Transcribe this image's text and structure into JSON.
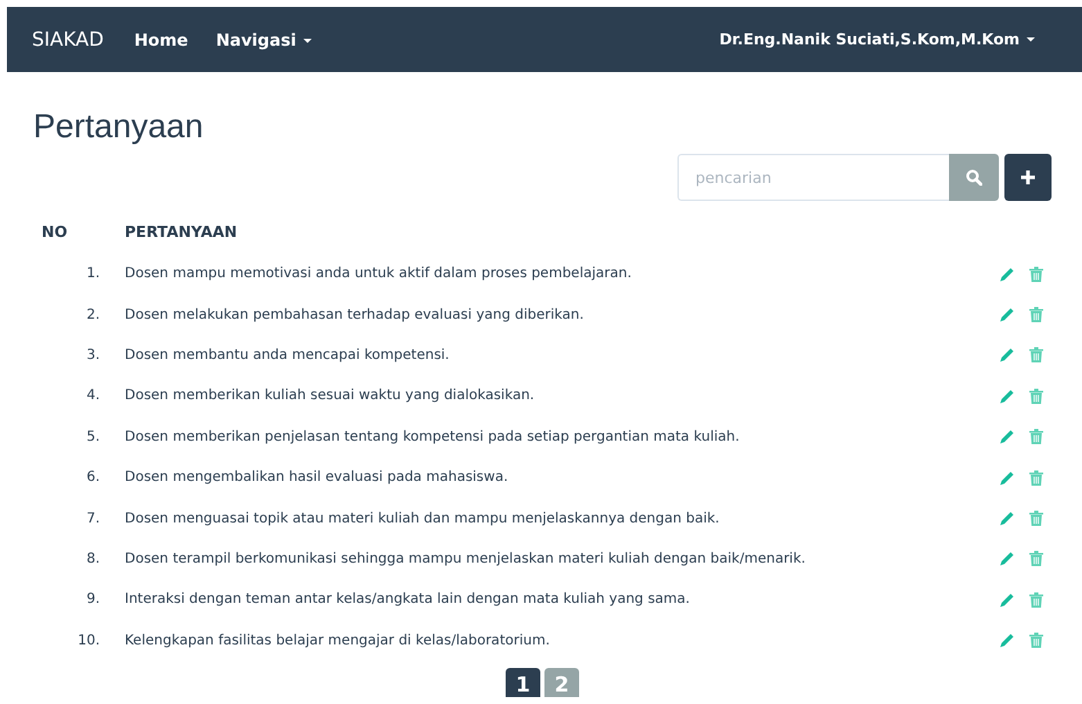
{
  "navbar": {
    "brand": "SIAKAD",
    "items": [
      {
        "label": "Home",
        "dropdown": false
      },
      {
        "label": "Navigasi",
        "dropdown": true
      }
    ],
    "user": {
      "label": "Dr.Eng.Nanik Suciati,S.Kom,M.Kom",
      "dropdown": true
    }
  },
  "title": "Pertanyaan",
  "search": {
    "placeholder": "pencarian"
  },
  "table": {
    "columns": [
      "NO",
      "PERTANYAAN"
    ],
    "rows": [
      {
        "no": "1.",
        "text": "Dosen mampu memotivasi anda untuk aktif dalam proses pembelajaran."
      },
      {
        "no": "2.",
        "text": "Dosen melakukan pembahasan terhadap evaluasi yang diberikan."
      },
      {
        "no": "3.",
        "text": "Dosen membantu anda mencapai kompetensi."
      },
      {
        "no": "4.",
        "text": "Dosen memberikan kuliah sesuai waktu yang dialokasikan."
      },
      {
        "no": "5.",
        "text": "Dosen memberikan penjelasan tentang kompetensi pada setiap pergantian mata kuliah."
      },
      {
        "no": "6.",
        "text": "Dosen mengembalikan hasil evaluasi pada mahasiswa."
      },
      {
        "no": "7.",
        "text": "Dosen menguasai topik atau materi kuliah dan mampu menjelaskannya dengan baik."
      },
      {
        "no": "8.",
        "text": "Dosen terampil berkomunikasi sehingga mampu menjelaskan materi kuliah dengan baik/menarik."
      },
      {
        "no": "9.",
        "text": "Interaksi dengan teman antar kelas/angkata lain dengan mata kuliah yang sama."
      },
      {
        "no": "10.",
        "text": "Kelengkapan fasilitas belajar mengajar di kelas/laboratorium."
      }
    ]
  },
  "pagination": [
    {
      "label": "1",
      "selected": true
    },
    {
      "label": "2",
      "selected": false
    }
  ]
}
